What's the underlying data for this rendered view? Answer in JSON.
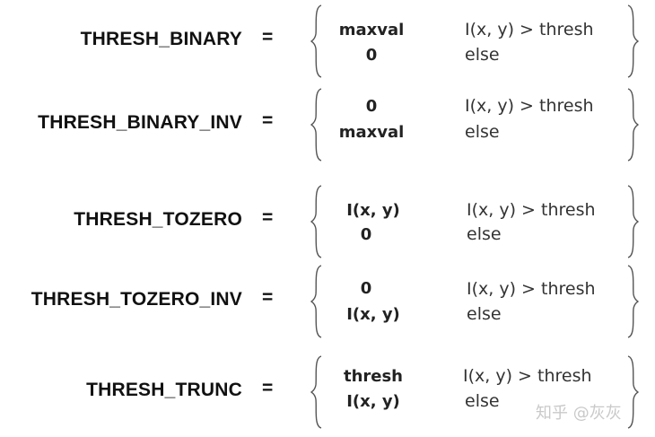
{
  "rows": [
    {
      "name": "THRESH_BINARY",
      "equals": "=",
      "value1": "maxval",
      "value2": "0",
      "cond1": "I(x, y) > thresh",
      "cond2": "else"
    },
    {
      "name": "THRESH_BINARY_INV",
      "equals": "=",
      "value1": "0",
      "value2": "maxval",
      "cond1": "I(x, y) > thresh",
      "cond2": "else"
    },
    {
      "name": "THRESH_TOZERO",
      "equals": "=",
      "value1": "I(x, y)",
      "value2": "0",
      "cond1": "I(x, y) > thresh",
      "cond2": "else"
    },
    {
      "name": "THRESH_TOZERO_INV",
      "equals": "=",
      "value1": "0",
      "value2": "I(x, y)",
      "cond1": "I(x, y) > thresh",
      "cond2": "else"
    },
    {
      "name": "THRESH_TRUNC",
      "equals": "=",
      "value1": "thresh",
      "value2": "I(x, y)",
      "cond1": "I(x, y) > thresh",
      "cond2": "else"
    }
  ],
  "watermark": "知乎 @灰灰"
}
